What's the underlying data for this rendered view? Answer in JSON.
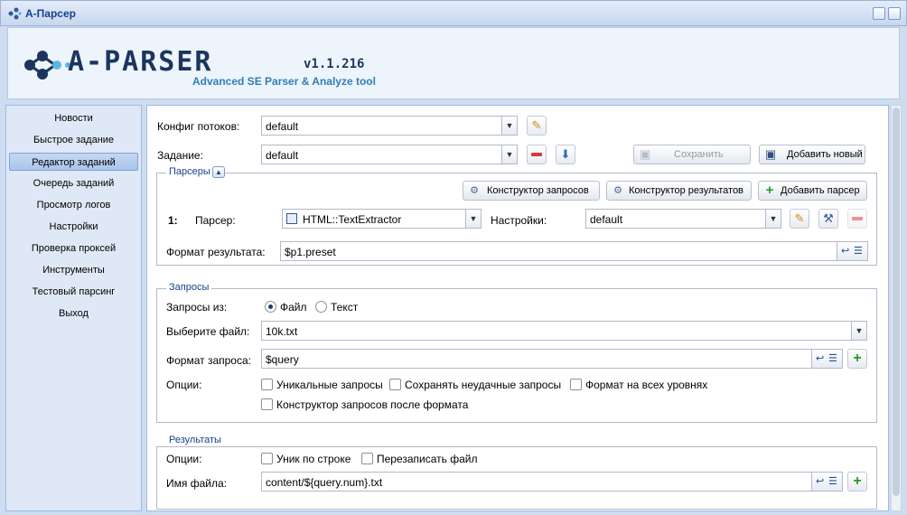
{
  "window": {
    "title": "A-Парсер"
  },
  "banner": {
    "logo_text": "A-PARSER",
    "version": "v1.1.216",
    "tagline": "Advanced SE Parser & Analyze tool"
  },
  "sidebar": {
    "items": [
      {
        "label": "Новости"
      },
      {
        "label": "Быстрое задание"
      },
      {
        "label": "Редактор заданий"
      },
      {
        "label": "Очередь заданий"
      },
      {
        "label": "Просмотр логов"
      },
      {
        "label": "Настройки"
      },
      {
        "label": "Проверка проксей"
      },
      {
        "label": "Инструменты"
      },
      {
        "label": "Тестовый парсинг"
      },
      {
        "label": "Выход"
      }
    ]
  },
  "form": {
    "threads_label": "Конфиг потоков:",
    "threads_value": "default",
    "task_label": "Задание:",
    "task_value": "default",
    "save_label": "Сохранить",
    "add_new_label": "Добавить новый"
  },
  "parsers": {
    "legend": "Парсеры",
    "query_builder_label": "Конструктор запросов",
    "result_builder_label": "Конструктор результатов",
    "add_parser_label": "Добавить парсер",
    "index": "1:",
    "parser_label": "Парсер:",
    "parser_value": "HTML::TextExtractor",
    "settings_label": "Настройки:",
    "settings_value": "default",
    "result_format_label": "Формат результата:",
    "result_format_value": "$p1.preset"
  },
  "queries": {
    "legend": "Запросы",
    "from_label": "Запросы из:",
    "opt_file": "Файл",
    "opt_text": "Текст",
    "file_label": "Выберите файл:",
    "file_value": "10k.txt",
    "format_label": "Формат запроса:",
    "format_value": "$query",
    "options_label": "Опции:",
    "unique": "Уникальные запросы",
    "save_failed": "Сохранять неудачные запросы",
    "format_all": "Формат на всех уровнях",
    "builder_after": "Конструктор запросов после формата"
  },
  "results": {
    "legend": "Результаты",
    "options_label": "Опции:",
    "unique_line": "Уник по строке",
    "overwrite": "Перезаписать файл",
    "filename_label": "Имя файла:",
    "filename_value": "content/${query.num}.txt"
  }
}
